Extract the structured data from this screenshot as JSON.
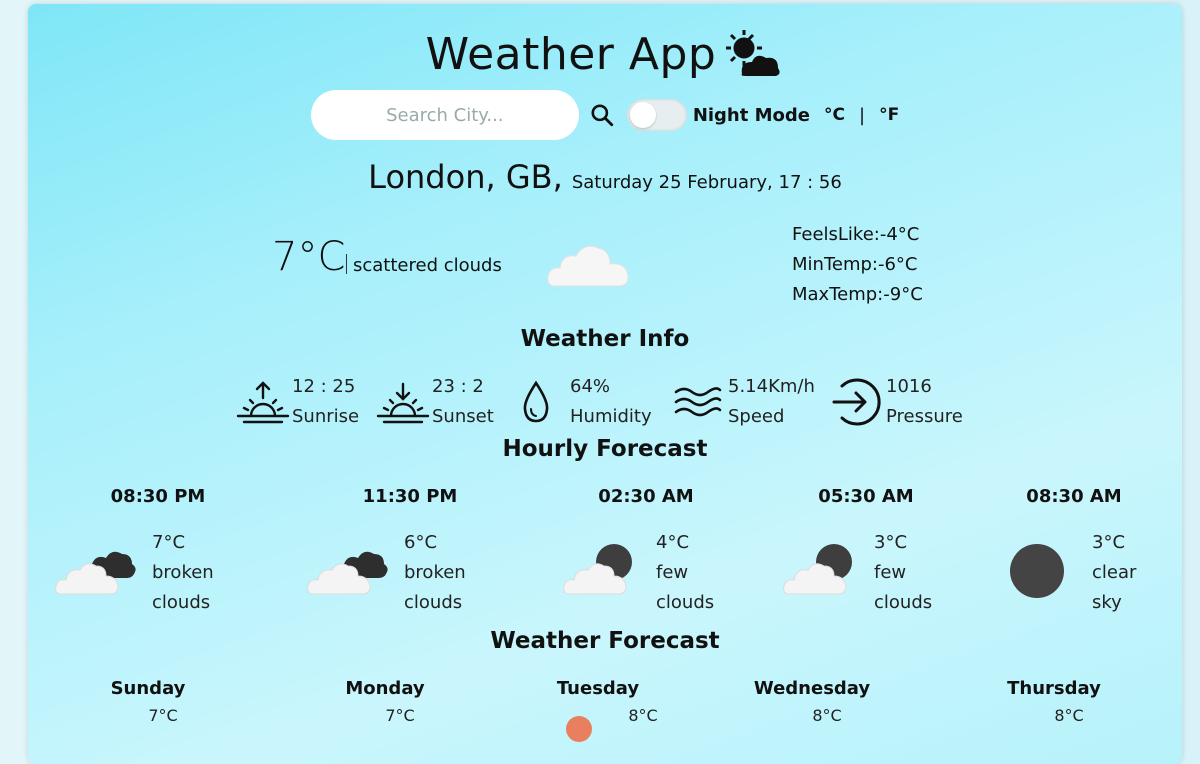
{
  "app": {
    "title": "Weather App"
  },
  "search": {
    "placeholder": "Search City...",
    "night_mode_label": "Night Mode",
    "unit_c": "°C",
    "unit_sep": "|",
    "unit_f": "°F"
  },
  "location": {
    "city": "London, GB,",
    "datetime": "Saturday 25 February, 17 : 56"
  },
  "current": {
    "temp": "7°C",
    "description": "scattered clouds",
    "feels_like": "FeelsLike:-4°C",
    "min_temp": "MinTemp:-6°C",
    "max_temp": "MaxTemp:-9°C"
  },
  "weather_info": {
    "title": "Weather Info",
    "items": [
      {
        "value": "12 : 25",
        "label": "Sunrise",
        "icon": "sunrise-icon"
      },
      {
        "value": "23 : 2",
        "label": "Sunset",
        "icon": "sunset-icon"
      },
      {
        "value": "64%",
        "label": "Humidity",
        "icon": "humidity-icon"
      },
      {
        "value": "5.14Km/h",
        "label": "Speed",
        "icon": "wind-icon"
      },
      {
        "value": "1016",
        "label": "Pressure",
        "icon": "pressure-icon"
      }
    ]
  },
  "hourly": {
    "title": "Hourly Forecast",
    "items": [
      {
        "time": "08:30 PM",
        "temp": "7°C",
        "desc1": "broken",
        "desc2": "clouds",
        "icon": "broken-clouds-icon"
      },
      {
        "time": "11:30 PM",
        "temp": "6°C",
        "desc1": "broken",
        "desc2": "clouds",
        "icon": "broken-clouds-icon"
      },
      {
        "time": "02:30 AM",
        "temp": "4°C",
        "desc1": "few",
        "desc2": "clouds",
        "icon": "few-clouds-night-icon"
      },
      {
        "time": "05:30 AM",
        "temp": "3°C",
        "desc1": "few",
        "desc2": "clouds",
        "icon": "few-clouds-night-icon"
      },
      {
        "time": "08:30 AM",
        "temp": "3°C",
        "desc1": "clear",
        "desc2": "sky",
        "icon": "clear-night-icon"
      }
    ]
  },
  "daily": {
    "title": "Weather Forecast",
    "items": [
      {
        "day": "Sunday",
        "temp": "7°C"
      },
      {
        "day": "Monday",
        "temp": "7°C"
      },
      {
        "day": "Tuesday",
        "temp": "8°C"
      },
      {
        "day": "Wednesday",
        "temp": "8°C"
      },
      {
        "day": "Thursday",
        "temp": "8°C"
      }
    ]
  },
  "colors": {
    "dark_cloud": "#2e2e2e",
    "moon": "#444444",
    "cloud": "#f4f4f4"
  }
}
